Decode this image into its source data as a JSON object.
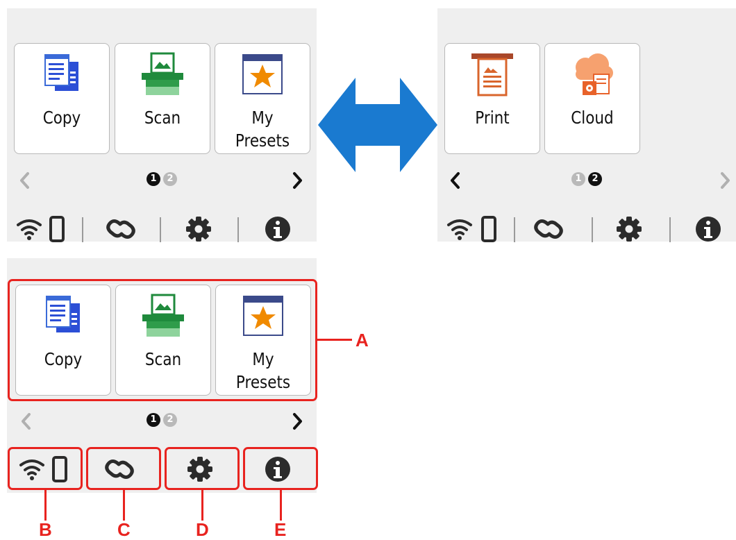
{
  "home1": {
    "tiles": [
      {
        "label": "Copy",
        "icon": "copy-icon"
      },
      {
        "label": "Scan",
        "icon": "scan-icon"
      },
      {
        "label": "My\nPresets",
        "icon": "my-presets-icon"
      }
    ],
    "page_dots": [
      "1",
      "2"
    ],
    "active_page": 1,
    "status_icons": [
      "wifi-icon",
      "smartphone-icon",
      "link-icon",
      "gear-icon",
      "info-icon"
    ]
  },
  "home2": {
    "tiles": [
      {
        "label": "Print",
        "icon": "print-icon"
      },
      {
        "label": "Cloud",
        "icon": "cloud-icon"
      }
    ],
    "page_dots": [
      "1",
      "2"
    ],
    "active_page": 2
  },
  "swap_arrow_icon": "double-arrow-icon",
  "callouts": {
    "A": "A",
    "B": "B",
    "C": "C",
    "D": "D",
    "E": "E"
  },
  "colors": {
    "panel": "#efefef",
    "callout": "#e8231f",
    "arrow": "#1a7ad0",
    "scan_green": "#1f8a3c",
    "copy_blue": "#2c4fd6",
    "star_orange": "#f08a00",
    "print_orange": "#d9652c"
  }
}
